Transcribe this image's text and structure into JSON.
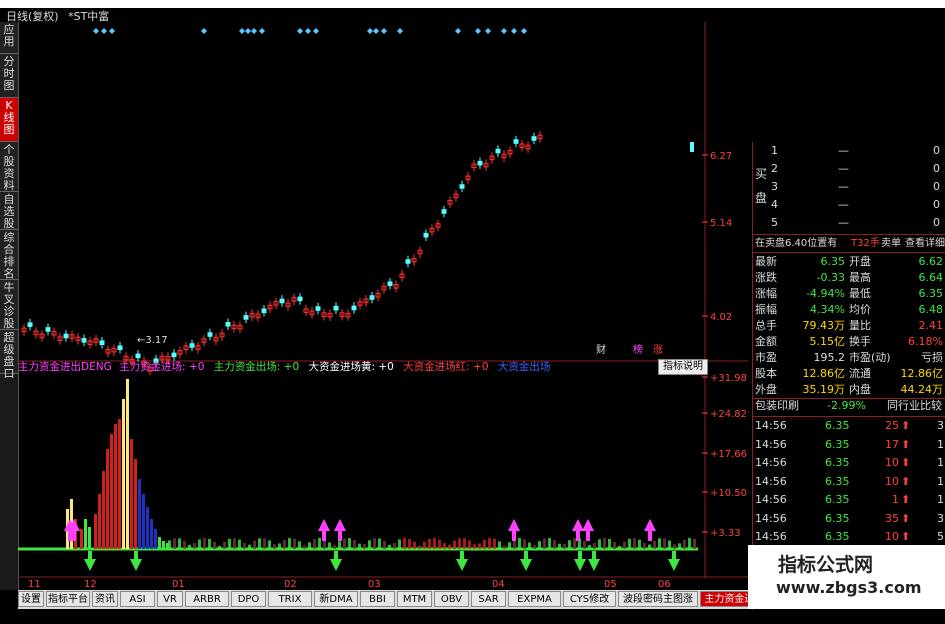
{
  "title_bar": {
    "period": "日线(复权)",
    "stock": "*ST中富"
  },
  "left_tabs": [
    {
      "label": "应用",
      "active": false
    },
    {
      "label": "分时图",
      "active": false
    },
    {
      "label": "K线图",
      "active": true
    },
    {
      "label": "个股资料",
      "active": false
    },
    {
      "label": "自选股",
      "active": false
    },
    {
      "label": "综合排名",
      "active": false
    },
    {
      "label": "牛叉诊股",
      "active": false
    },
    {
      "label": "超级盘口",
      "active": false
    }
  ],
  "price_axis": [
    "6.27",
    "5.14",
    "4.02"
  ],
  "price_low_label": "3.17",
  "markers": [
    "财",
    "榜",
    "涨"
  ],
  "indicator_axis": [
    "+31.98",
    "+24.82",
    "+17.66",
    "+10.50",
    "+3.33"
  ],
  "date_axis": [
    "11",
    "12",
    "01",
    "02",
    "03",
    "04",
    "05",
    "06"
  ],
  "indicator_bar": {
    "name": "主力资金进出DENG",
    "s1": "主力资金进场: +0",
    "s2": "主力资金出场: +0",
    "s3": "大资金进场黄: +0",
    "s4": "大资金进场红: +0",
    "s5": "大资金出场",
    "button": "指标说明"
  },
  "orderbook": {
    "buy_label": "买盘",
    "rows": [
      {
        "level": "1",
        "price": "—",
        "right": "0"
      },
      {
        "level": "2",
        "price": "—",
        "right": "0"
      },
      {
        "level": "3",
        "price": "—",
        "right": "0"
      },
      {
        "level": "4",
        "price": "—",
        "right": "0"
      },
      {
        "level": "5",
        "price": "—",
        "right": "0"
      }
    ]
  },
  "sell_info": {
    "text": "在卖盘6.40位置有",
    "qty": "T32手",
    "link1": "卖单",
    "link2": "查看详细"
  },
  "quote": [
    {
      "l1": "最新",
      "v1": "6.35",
      "c1": "green",
      "l2": "开盘",
      "v2": "6.62",
      "c2": "green"
    },
    {
      "l1": "涨跌",
      "v1": "-0.33",
      "c1": "green",
      "l2": "最高",
      "v2": "6.64",
      "c2": "green"
    },
    {
      "l1": "涨幅",
      "v1": "-4.94%",
      "c1": "green",
      "l2": "最低",
      "v2": "6.35",
      "c2": "green"
    },
    {
      "l1": "振幅",
      "v1": "4.34%",
      "c1": "green",
      "l2": "均价",
      "v2": "6.48",
      "c2": "green"
    },
    {
      "l1": "总手",
      "v1": "79.43万",
      "c1": "yellow",
      "l2": "量比",
      "v2": "2.41",
      "c2": "red"
    },
    {
      "l1": "金额",
      "v1": "5.15亿",
      "c1": "yellow",
      "l2": "换手",
      "v2": "6.18%",
      "c2": "red"
    },
    {
      "l1": "市盈",
      "v1": "195.2",
      "c1": "white",
      "l2": "市盈(动)",
      "v2": "亏损",
      "c2": "white"
    },
    {
      "l1": "股本",
      "v1": "12.86亿",
      "c1": "yellow",
      "l2": "流通",
      "v2": "12.86亿",
      "c2": "yellow"
    },
    {
      "l1": "外盘",
      "v1": "35.19万",
      "c1": "yellow",
      "l2": "内盘",
      "v2": "44.24万",
      "c2": "yellow"
    }
  ],
  "sector": {
    "name": "包装印刷",
    "change": "-2.99%",
    "link": "同行业比较"
  },
  "ticks": [
    {
      "time": "14:56",
      "price": "6.35",
      "vol": "25",
      "tail": "3"
    },
    {
      "time": "14:56",
      "price": "6.35",
      "vol": "17",
      "tail": "1"
    },
    {
      "time": "14:56",
      "price": "6.35",
      "vol": "10",
      "tail": "1"
    },
    {
      "time": "14:56",
      "price": "6.35",
      "vol": "10",
      "tail": "1"
    },
    {
      "time": "14:56",
      "price": "6.35",
      "vol": "1",
      "tail": "1"
    },
    {
      "time": "14:56",
      "price": "6.35",
      "vol": "35",
      "tail": "3"
    },
    {
      "time": "14:56",
      "price": "6.35",
      "vol": "10",
      "tail": "5"
    },
    {
      "time": "14:56",
      "price": "6.35",
      "vol": "8",
      "tail": "1"
    }
  ],
  "bottom_tabs": [
    "设置",
    "指标平台",
    "资讯",
    "ASI",
    "VR",
    "ARBR",
    "DPO",
    "TRIX",
    "新DMA",
    "BBI",
    "MTM",
    "OBV",
    "SAR",
    "EXPMA",
    "CYS修改",
    "波段密码主图涨码",
    "主力资金进出DENG"
  ],
  "active_bottom_tab": "主力资金进出DENG",
  "watermark": {
    "line1": "指标公式网",
    "line2": "www.zbgs3.com"
  },
  "colors": {
    "up": "#ff3030",
    "down": "#54ffff",
    "green": "#3fe63f",
    "bar_red": "#d02020",
    "bar_yellow": "#ffe87a",
    "bar_blue": "#2030c0",
    "magenta": "#ff40ff"
  }
}
